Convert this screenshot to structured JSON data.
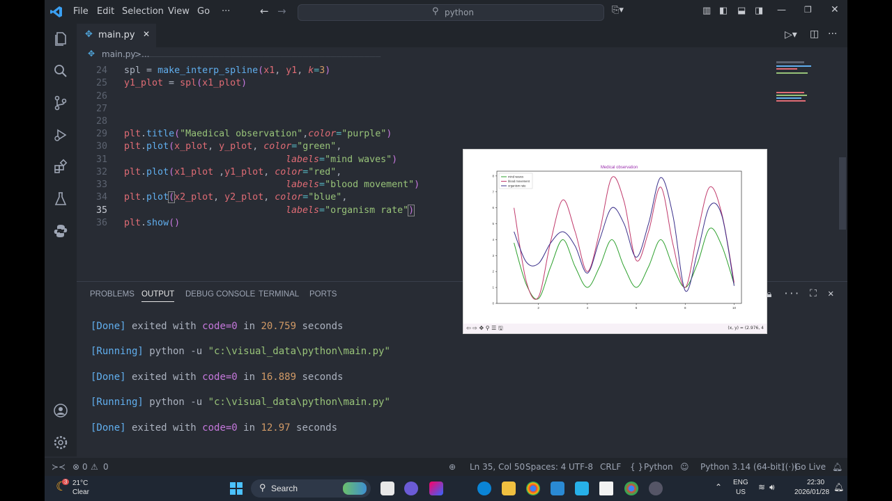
{
  "menu": {
    "file": "File",
    "edit": "Edit",
    "selection": "Selection",
    "view": "View",
    "go": "Go",
    "more": "···"
  },
  "search": {
    "text": "python"
  },
  "tab": {
    "name": "main.py",
    "close": "✕"
  },
  "breadcrumb": {
    "file": "main.py",
    "sep": ">",
    "more": "..."
  },
  "editor": {
    "lines": [
      {
        "n": "24"
      },
      {
        "n": "25"
      },
      {
        "n": "26"
      },
      {
        "n": "27"
      },
      {
        "n": "28"
      },
      {
        "n": "29"
      },
      {
        "n": "30"
      },
      {
        "n": "31"
      },
      {
        "n": "32"
      },
      {
        "n": "33"
      },
      {
        "n": "34"
      },
      {
        "n": "35"
      },
      {
        "n": "36"
      }
    ],
    "code": {
      "l24a": "spl",
      "l24b": " = ",
      "l24c": "make_interp_spline",
      "l24d": "(",
      "l24e": "x1",
      "l24f": ", ",
      "l24g": "y1",
      "l24h": ", ",
      "l24i": "k",
      "l24j": "=",
      "l24k": "3",
      "l24l": ")",
      "l25a": "y1_plot",
      "l25b": " = ",
      "l25c": "spl",
      "l25d": "(",
      "l25e": "x1_plot",
      "l25f": ")",
      "l29a": "plt",
      "l29b": ".",
      "l29c": "title",
      "l29d": "(",
      "l29e": "\"Maedical observation\"",
      "l29f": ",",
      "l29g": "color",
      "l29h": "=",
      "l29i": "\"purple\"",
      "l29j": ")",
      "l30a": "plt",
      "l30b": ".",
      "l30c": "plot",
      "l30d": "(",
      "l30e": "x_plot",
      "l30f": ", ",
      "l30g": "y_plot",
      "l30h": ", ",
      "l30i": "color",
      "l30j": "=",
      "l30k": "\"green\"",
      "l30l": ",",
      "l31a": "labels",
      "l31b": "=",
      "l31c": "\"mind waves\"",
      "l31d": ")",
      "l32a": "plt",
      "l32b": ".",
      "l32c": "plot",
      "l32d": "(",
      "l32e": "x1_plot",
      "l32f": " ,",
      "l32g": "y1_plot",
      "l32h": ", ",
      "l32i": "color",
      "l32j": "=",
      "l32k": "\"red\"",
      "l32l": ",",
      "l33a": "labels",
      "l33b": "=",
      "l33c": "\"blood movement\"",
      "l33d": ")",
      "l34a": "plt",
      "l34b": ".",
      "l34c": "plot",
      "l34d": "(",
      "l34e": "x2_plot",
      "l34f": ", ",
      "l34g": "y2_plot",
      "l34h": ", ",
      "l34i": "color",
      "l34j": "=",
      "l34k": "\"blue\"",
      "l34l": ",",
      "l35a": "labels",
      "l35b": "=",
      "l35c": "\"organism rate\"",
      "l35d": ")",
      "l36a": "plt",
      "l36b": ".",
      "l36c": "show",
      "l36d": "()"
    }
  },
  "panel": {
    "tabs": {
      "problems": "PROBLEMS",
      "output": "OUTPUT",
      "debug": "DEBUG CONSOLE",
      "terminal": "TERMINAL",
      "ports": "PORTS"
    },
    "output": [
      {
        "status": "[Done]",
        "text": " exited with ",
        "code": "code=0",
        "in": " in ",
        "time": "20.759",
        "unit": " seconds"
      },
      {
        "status": "[Running]",
        "cmd": " python -u ",
        "path": "\"c:\\visual_data\\python\\main.py\""
      },
      {
        "status": "[Done]",
        "text": " exited with ",
        "code": "code=0",
        "in": " in ",
        "time": "16.889",
        "unit": " seconds"
      },
      {
        "status": "[Running]",
        "cmd": " python -u ",
        "path": "\"c:\\visual_data\\python\\main.py\""
      },
      {
        "status": "[Done]",
        "text": " exited with ",
        "code": "code=0",
        "in": " in ",
        "time": "12.97",
        "unit": " seconds"
      }
    ]
  },
  "status": {
    "errors": "0",
    "warnings": "0",
    "position": "Ln 35, Col 50",
    "spaces": "Spaces: 4",
    "encoding": "UTF-8",
    "eol": "CRLF",
    "language": "Python",
    "interpreter": "Python 3.14 (64-bit)",
    "golive": "Go Live"
  },
  "taskbar": {
    "weather_temp": "21°C",
    "weather_desc": "Clear",
    "weather_badge": "3",
    "search": "Search",
    "lang1": "ENG",
    "lang2": "US",
    "time": "22:30",
    "date": "2026/01/28"
  },
  "plot": {
    "title": "Medical observation",
    "toolbar": "⇦ ⇨ ✥ ⚲ ☰ 🖫",
    "coords": "(x, y) = (2.976, 4"
  },
  "chart_data": {
    "type": "line",
    "title": "Medical observation",
    "xlim": [
      0.3,
      10.3
    ],
    "ylim": [
      0,
      8.3
    ],
    "xticks": [
      2,
      4,
      6,
      8,
      10
    ],
    "yticks": [
      0,
      1,
      2,
      3,
      4,
      5,
      6,
      7,
      8
    ],
    "legend": "top-left",
    "series": [
      {
        "name": "mind waves",
        "color": "#2ca02c",
        "x": [
          1,
          1.5,
          2,
          2.5,
          3,
          3.5,
          4,
          4.5,
          5,
          5.5,
          6,
          6.5,
          7,
          7.5,
          8,
          8.5,
          9,
          9.5,
          10
        ],
        "y": [
          3.8,
          1.2,
          0.3,
          2.3,
          4.0,
          2.3,
          1.0,
          2.3,
          4.0,
          2.3,
          1.0,
          2.3,
          4.0,
          2.3,
          1.0,
          2.5,
          4.7,
          3.6,
          1.2
        ]
      },
      {
        "name": "blood movement",
        "color": "#c0396b",
        "x": [
          1,
          1.5,
          2,
          2.5,
          3,
          3.5,
          4,
          4.5,
          5,
          5.5,
          6,
          6.5,
          7,
          7.5,
          8,
          8.5,
          9,
          9.5,
          10
        ],
        "y": [
          6.0,
          1.4,
          0.4,
          3.9,
          6.5,
          4.5,
          2.0,
          4.5,
          7.9,
          6.4,
          2.7,
          4.5,
          7.3,
          3.7,
          1.0,
          4.4,
          7.3,
          5.6,
          1.3
        ]
      },
      {
        "name": "organism rate",
        "color": "#3a2f8a",
        "x": [
          1,
          1.5,
          2,
          2.5,
          3,
          3.5,
          4,
          4.5,
          5,
          5.5,
          6,
          6.5,
          7,
          7.5,
          8,
          8.5,
          9,
          9.5,
          10
        ],
        "y": [
          4.5,
          2.6,
          2.5,
          3.8,
          4.5,
          3.6,
          1.9,
          4.0,
          6.0,
          5.0,
          2.9,
          5.0,
          7.9,
          5.5,
          0.8,
          3.2,
          6.1,
          5.5,
          1.1
        ]
      }
    ]
  }
}
